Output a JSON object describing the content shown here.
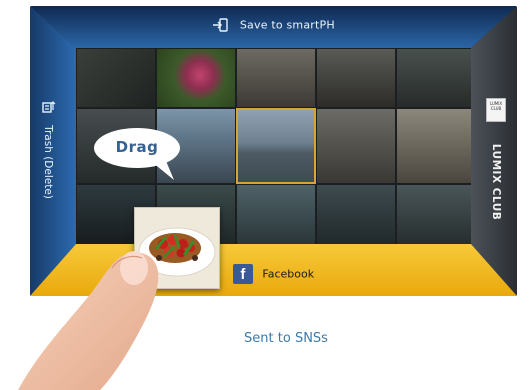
{
  "top_action": {
    "label": "Save to smartPH",
    "icon": "phone-save-icon"
  },
  "left_action": {
    "label": "Trash (Delete)",
    "icon": "trash-icon"
  },
  "right_action": {
    "label": "LUMIX CLUB",
    "logo_text": "LUMIX CLUB",
    "icon": "lumix-club-logo"
  },
  "bottom_action": {
    "label": "Facebook",
    "icon": "facebook-icon",
    "icon_glyph": "f"
  },
  "hint": {
    "label": "Drag"
  },
  "caption": "Sent to SNSs",
  "colors": {
    "top_frame": "#173f73",
    "side_frame": "#1f4f8a",
    "right_frame": "#3a3f44",
    "bottom_frame": "#f2b718",
    "facebook": "#3b5998",
    "caption": "#3d7aa8",
    "bubble_text": "#356293"
  }
}
